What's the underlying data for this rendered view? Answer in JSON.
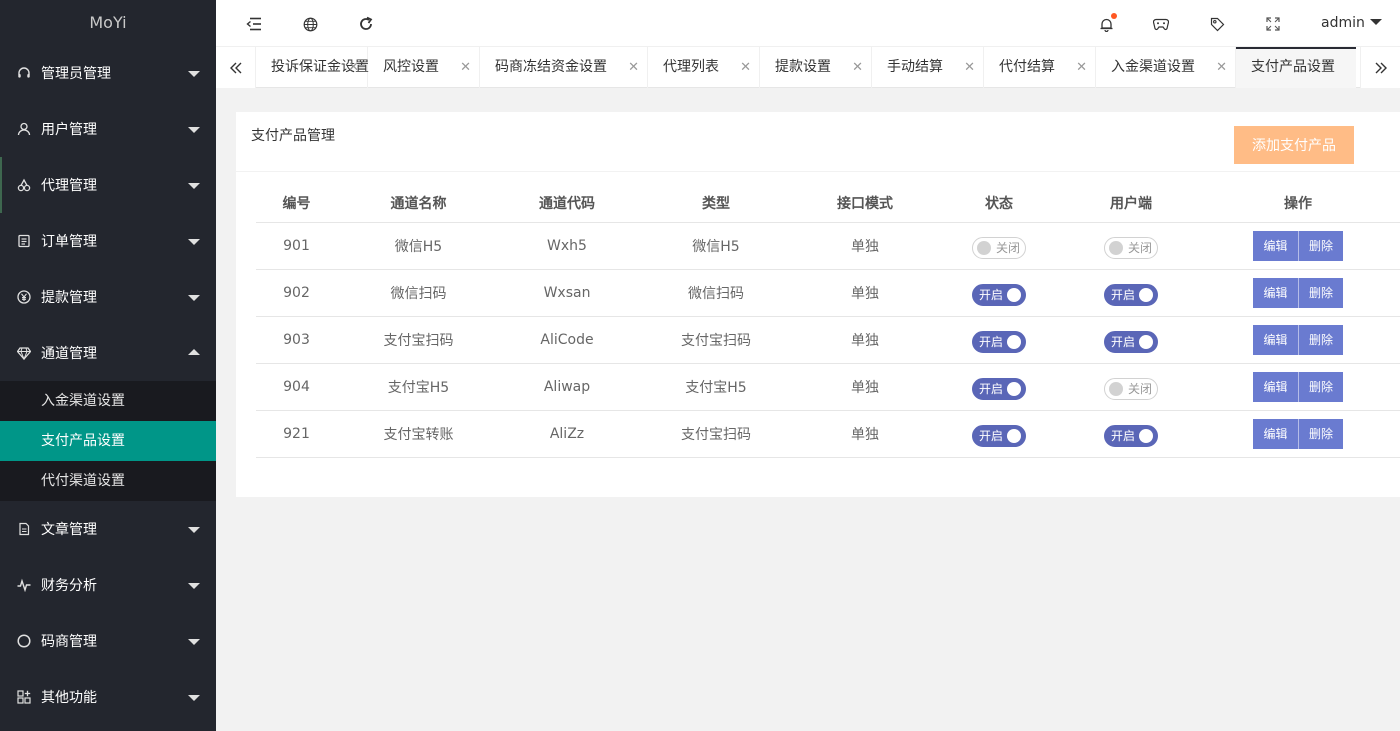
{
  "app": {
    "logo": "MoYi"
  },
  "sidebar": {
    "items": [
      {
        "label": "管理员管理",
        "icon": "headset-icon"
      },
      {
        "label": "用户管理",
        "icon": "user-icon"
      },
      {
        "label": "代理管理",
        "icon": "agent-icon"
      },
      {
        "label": "订单管理",
        "icon": "order-icon"
      },
      {
        "label": "提款管理",
        "icon": "yen-icon"
      },
      {
        "label": "通道管理",
        "icon": "diamond-icon"
      }
    ],
    "channel_sub": [
      {
        "label": "入金渠道设置"
      },
      {
        "label": "支付产品设置"
      },
      {
        "label": "代付渠道设置"
      }
    ],
    "items_after": [
      {
        "label": "文章管理",
        "icon": "article-icon"
      },
      {
        "label": "财务分析",
        "icon": "pulse-icon"
      },
      {
        "label": "码商管理",
        "icon": "circle-icon"
      },
      {
        "label": "其他功能",
        "icon": "apps-icon"
      }
    ]
  },
  "header": {
    "user": "admin"
  },
  "tabs": [
    {
      "label": "投诉保证金设置"
    },
    {
      "label": "风控设置"
    },
    {
      "label": "码商冻结资金设置"
    },
    {
      "label": "代理列表"
    },
    {
      "label": "提款设置"
    },
    {
      "label": "手动结算"
    },
    {
      "label": "代付结算"
    },
    {
      "label": "入金渠道设置"
    },
    {
      "label": "支付产品设置"
    }
  ],
  "card": {
    "title": "支付产品管理",
    "add_button": "添加支付产品"
  },
  "table": {
    "columns": [
      "编号",
      "通道名称",
      "通道代码",
      "类型",
      "接口模式",
      "状态",
      "用户端",
      "操作"
    ],
    "rows": [
      {
        "id": "901",
        "name": "微信H5",
        "code": "Wxh5",
        "type": "微信H5",
        "mode": "单独",
        "status": "关闭",
        "client": "关闭"
      },
      {
        "id": "902",
        "name": "微信扫码",
        "code": "Wxsan",
        "type": "微信扫码",
        "mode": "单独",
        "status": "开启",
        "client": "开启"
      },
      {
        "id": "903",
        "name": "支付宝扫码",
        "code": "AliCode",
        "type": "支付宝扫码",
        "mode": "单独",
        "status": "开启",
        "client": "开启"
      },
      {
        "id": "904",
        "name": "支付宝H5",
        "code": "Aliwap",
        "type": "支付宝H5",
        "mode": "单独",
        "status": "开启",
        "client": "关闭"
      },
      {
        "id": "921",
        "name": "支付宝转账",
        "code": "AliZz",
        "type": "支付宝扫码",
        "mode": "单独",
        "status": "开启",
        "client": "开启"
      }
    ],
    "edit_label": "编辑",
    "delete_label": "删除"
  },
  "colors": {
    "sidebar_bg": "#23262e",
    "active_sub": "#009688",
    "switch_on": "#5a66b7",
    "op_button": "#6a7bd0",
    "add_button": "#ffb980"
  }
}
